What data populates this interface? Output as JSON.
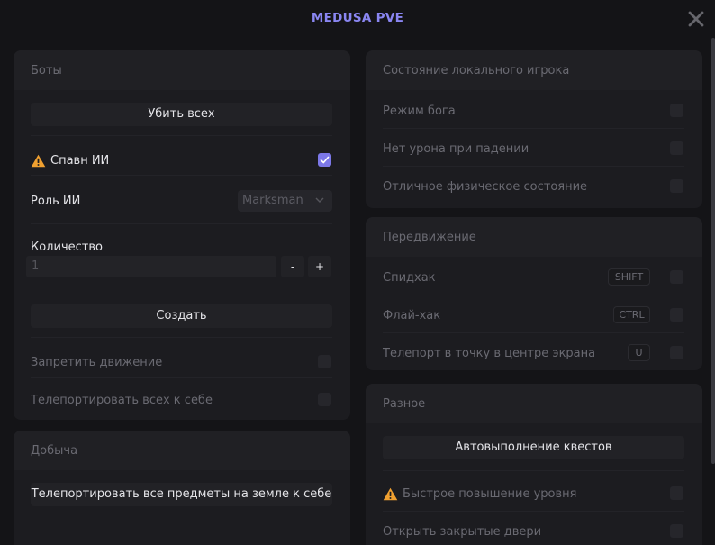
{
  "window": {
    "title": "MEDUSA PVE"
  },
  "bots": {
    "title": "Боты",
    "kill_all": "Убить всех",
    "spawn_ai": {
      "label": "Спавн ИИ",
      "checked": true
    },
    "ai_role": {
      "label": "Роль ИИ",
      "selected": "Marksman"
    },
    "quantity": {
      "label": "Количество",
      "value": "1",
      "minus": "-",
      "plus": "+"
    },
    "create": "Создать",
    "forbid_movement": {
      "label": "Запретить движение",
      "checked": false
    },
    "teleport_all_to_self": {
      "label": "Телепортировать всех к себе",
      "checked": false
    }
  },
  "loot": {
    "title": "Добыча",
    "teleport_items": "Телепортировать все предметы на земле к себе"
  },
  "local_player": {
    "title": "Состояние локального игрока",
    "god_mode": {
      "label": "Режим бога",
      "checked": false
    },
    "no_fall_damage": {
      "label": "Нет урона при падении",
      "checked": false
    },
    "perfect_physical": {
      "label": "Отличное физическое состояние",
      "checked": false
    }
  },
  "movement": {
    "title": "Передвижение",
    "speedhack": {
      "label": "Спидхак",
      "key": "SHIFT",
      "checked": false
    },
    "flyhack": {
      "label": "Флай-хак",
      "key": "CTRL",
      "checked": false
    },
    "teleport_center": {
      "label": "Телепорт в точку в центре экрана",
      "key": "U",
      "checked": false
    }
  },
  "misc": {
    "title": "Разное",
    "auto_quests": "Автовыполнение квестов",
    "fast_level": {
      "label": "Быстрое повышение уровня",
      "checked": false
    },
    "open_doors": {
      "label": "Открыть закрытые двери",
      "checked": false
    }
  },
  "colors": {
    "accent": "#7c78e8",
    "title": "#8a86f2",
    "warning": "#f0a030",
    "background": "#141417",
    "panel": "#1c1c20"
  }
}
